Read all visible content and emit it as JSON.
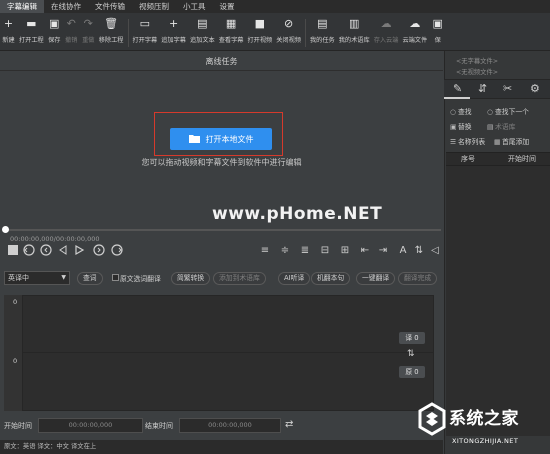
{
  "menu": [
    "字幕编辑",
    "在线协作",
    "文件传输",
    "视频压制",
    "小工具",
    "设置"
  ],
  "toolbar": [
    {
      "icon": "new-icon",
      "label": "新建",
      "glyph": "+"
    },
    {
      "icon": "open-project-icon",
      "label": "打开工程",
      "glyph": "▬"
    },
    {
      "icon": "save-icon",
      "label": "保存",
      "glyph": "▣"
    },
    {
      "icon": "undo-icon",
      "label": "撤销",
      "glyph": "↶"
    },
    {
      "icon": "redo-icon",
      "label": "重做",
      "glyph": "↷"
    },
    {
      "icon": "remove-project-icon",
      "label": "移除工程",
      "glyph": "🗑"
    },
    {
      "icon": "open-subtitle-icon",
      "label": "打开字幕",
      "glyph": "▭"
    },
    {
      "icon": "add-subtitle-icon",
      "label": "追加字幕",
      "glyph": "+"
    },
    {
      "icon": "add-text-icon",
      "label": "追加文本",
      "glyph": "▤"
    },
    {
      "icon": "view-subtitle-icon",
      "label": "查看字幕",
      "glyph": "▦"
    },
    {
      "icon": "open-video-icon",
      "label": "打开视频",
      "glyph": "■"
    },
    {
      "icon": "close-video-icon",
      "label": "关闭视频",
      "glyph": "⊘"
    },
    {
      "icon": "my-tasks-icon",
      "label": "我的任务",
      "glyph": "▤"
    },
    {
      "icon": "my-termbase-icon",
      "label": "我的术语库",
      "glyph": "▥"
    },
    {
      "icon": "cloud-save-icon",
      "label": "存入云端",
      "glyph": "☁"
    },
    {
      "icon": "cloud-file-icon",
      "label": "云端文件",
      "glyph": "☁"
    },
    {
      "icon": "save-more-icon",
      "label": "保",
      "glyph": "▣"
    }
  ],
  "main": {
    "task_title": "离线任务",
    "open_button": "打开本地文件",
    "drag_hint": "您可以拖动视频和字幕文件到软件中进行编辑",
    "watermark": "www.pHome.NET",
    "time_readout": "00:00:00,000/00:00:00,000"
  },
  "subtitle_toolbar": {
    "language": "英译中",
    "query": "查词",
    "checkbox_label": "原文选词翻译",
    "simp_trad": "简繁转换",
    "add_term": "添加到术语库",
    "ai_translate": "AI听译",
    "machine_translate": "机翻本句",
    "one_click": "一键翻译",
    "translate_done": "翻译完成"
  },
  "editor": {
    "line_top": "0",
    "line_bottom": "0",
    "translation_count": "译 0",
    "original_count": "原 0"
  },
  "bottom": {
    "start_label": "开始时间",
    "start_value": "00:00:00,000",
    "end_label": "结束时间",
    "end_value": "00:00:00,000"
  },
  "status": "原文：英语  译文：中文    译文在上",
  "right_panel": {
    "subtitle_file": "<无字幕文件>",
    "video_file": "<无视频文件>",
    "find": "查找",
    "find_next": "查找下一个",
    "replace": "替换",
    "termbase": "术语库",
    "names_list": "名称列表",
    "head_tail_add": "首尾添加",
    "col_index": "序号",
    "col_start": "开始时间"
  },
  "logo": {
    "main": "系统之家",
    "sub": "XITONGZHIJIA.NET"
  },
  "colors": {
    "accent_button": "#2f8fef",
    "highlight_box": "#d63a2c",
    "background": "#3c3f41"
  }
}
